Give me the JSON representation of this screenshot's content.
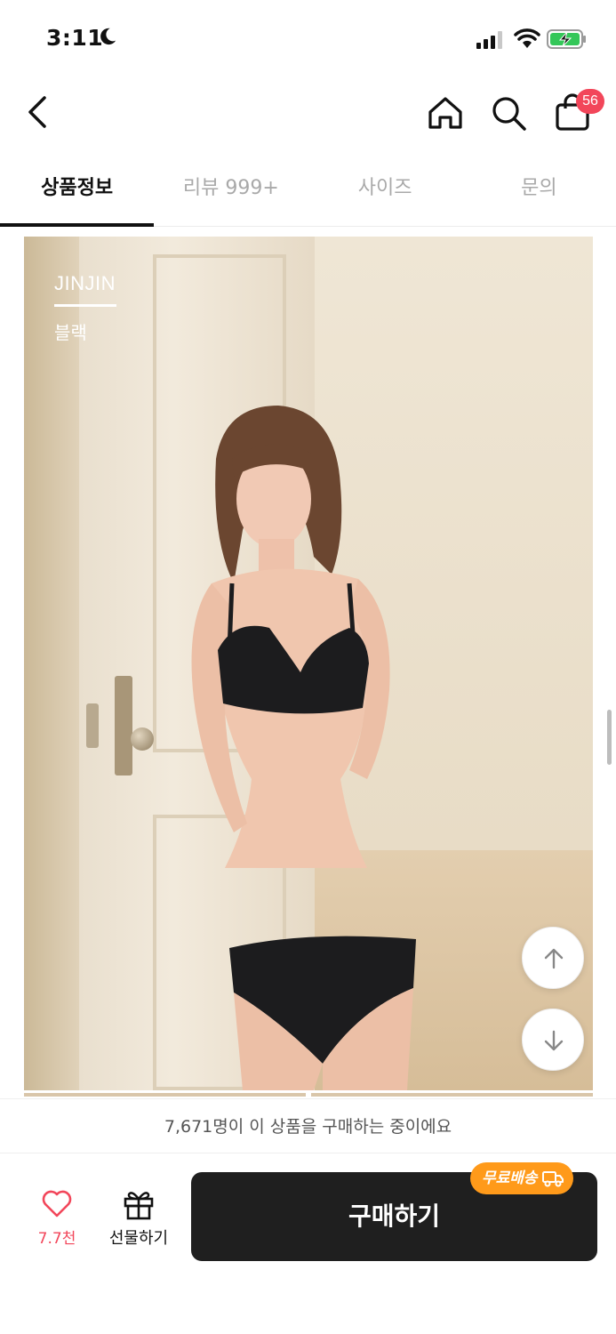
{
  "status_bar": {
    "time": "3:11"
  },
  "header": {
    "cart_count": "56"
  },
  "tabs": [
    {
      "label": "상품정보",
      "active": true
    },
    {
      "label": "리뷰 999+",
      "active": false
    },
    {
      "label": "사이즈",
      "active": false
    },
    {
      "label": "문의",
      "active": false
    }
  ],
  "product_image": {
    "brand": "JINJIN",
    "color": "블랙"
  },
  "banner": {
    "buying_text": "7,671명이 이 상품을 구매하는 중이에요"
  },
  "bottom_bar": {
    "like_count": "7.7천",
    "gift_label": "선물하기",
    "buy_label": "구매하기",
    "free_shipping_label": "무료배송"
  },
  "colors": {
    "accent": "#f2465a",
    "buy_button": "#1f1f1f",
    "shipping_badge": "#ff9a1a"
  },
  "icons": [
    "moon-icon",
    "signal-icon",
    "wifi-icon",
    "battery-charging-icon",
    "back-arrow-icon",
    "home-icon",
    "search-icon",
    "shopping-bag-icon",
    "arrow-up-icon",
    "arrow-down-icon",
    "heart-icon",
    "gift-icon",
    "truck-icon"
  ]
}
